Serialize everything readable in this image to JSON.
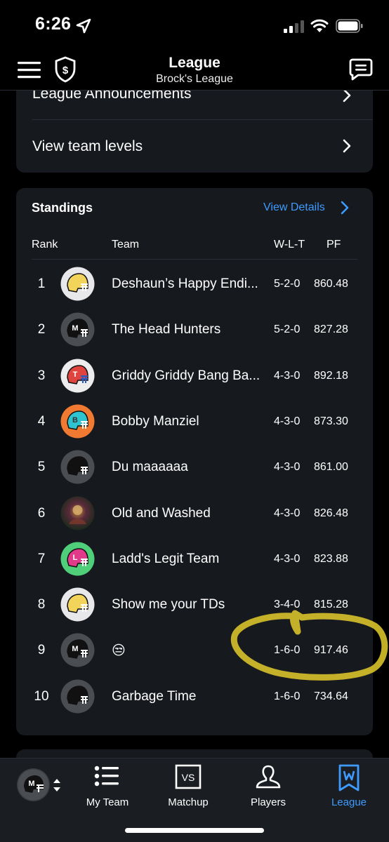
{
  "status": {
    "time": "6:26"
  },
  "header": {
    "title": "League",
    "subtitle": "Brock's League"
  },
  "top_card": {
    "announcements_label": "League Announcements",
    "team_levels_label": "View team levels"
  },
  "standings": {
    "title": "Standings",
    "view_details": "View Details",
    "columns": {
      "rank": "Rank",
      "team": "Team",
      "wlt": "W-L-T",
      "pf": "PF"
    },
    "rows": [
      {
        "rank": "1",
        "team": "Deshaun’s Happy Endi...",
        "wlt": "5-2-0",
        "pf": "860.48",
        "avatar": "helmet-yellow-icon"
      },
      {
        "rank": "2",
        "team": "The Head Hunters",
        "wlt": "5-2-0",
        "pf": "827.28",
        "avatar": "helmet-m-icon"
      },
      {
        "rank": "3",
        "team": "Griddy Griddy Bang Ba...",
        "wlt": "4-3-0",
        "pf": "892.18",
        "avatar": "helmet-t-icon"
      },
      {
        "rank": "4",
        "team": "Bobby Manziel",
        "wlt": "4-3-0",
        "pf": "873.30",
        "avatar": "helmet-b-icon"
      },
      {
        "rank": "5",
        "team": "Du maaaaaa",
        "wlt": "4-3-0",
        "pf": "861.00",
        "avatar": "helmet-dark-icon"
      },
      {
        "rank": "6",
        "team": "Old and Washed",
        "wlt": "4-3-0",
        "pf": "826.48",
        "avatar": "photo-avatar"
      },
      {
        "rank": "7",
        "team": "Ladd's Legit Team",
        "wlt": "4-3-0",
        "pf": "823.88",
        "avatar": "helmet-l-icon"
      },
      {
        "rank": "8",
        "team": "Show me your TDs",
        "wlt": "3-4-0",
        "pf": "815.28",
        "avatar": "helmet-yellow-icon"
      },
      {
        "rank": "9",
        "team": "😒",
        "wlt": "1-6-0",
        "pf": "917.46",
        "avatar": "helmet-m-icon"
      },
      {
        "rank": "10",
        "team": "Garbage Time",
        "wlt": "1-6-0",
        "pf": "734.64",
        "avatar": "helmet-dark-icon"
      }
    ]
  },
  "tabbar": {
    "tabs": [
      {
        "label": "My Team",
        "icon": "list-icon",
        "active": false
      },
      {
        "label": "Matchup",
        "icon": "vs-icon",
        "active": false
      },
      {
        "label": "Players",
        "icon": "person-icon",
        "active": false
      },
      {
        "label": "League",
        "icon": "league-bookmark-icon",
        "active": true
      }
    ]
  },
  "colors": {
    "accent": "#3e9bff",
    "card": "#16191e",
    "highlight": "#d8c22a"
  }
}
